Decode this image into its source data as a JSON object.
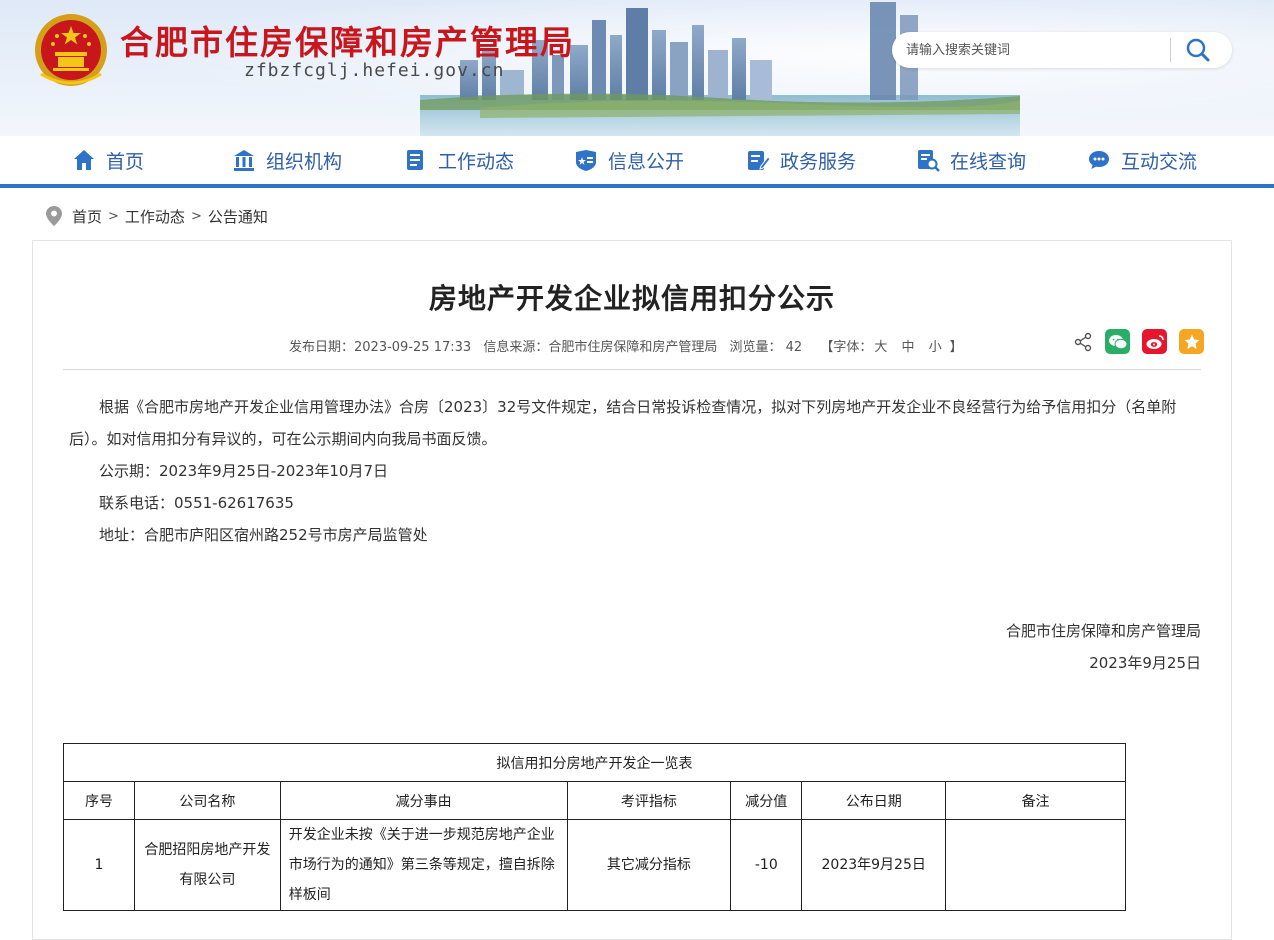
{
  "header": {
    "site_title": "合肥市住房保障和房产管理局",
    "site_domain": "zfbzfcglj.hefei.gov.cn",
    "search": {
      "placeholder": "请输入搜索关键词"
    }
  },
  "nav": {
    "items": [
      {
        "label": "首页",
        "icon": "home-icon"
      },
      {
        "label": "组织机构",
        "icon": "building-icon"
      },
      {
        "label": "工作动态",
        "icon": "document-icon"
      },
      {
        "label": "信息公开",
        "icon": "info-shield-icon"
      },
      {
        "label": "政务服务",
        "icon": "edit-icon"
      },
      {
        "label": "在线查询",
        "icon": "search-doc-icon"
      },
      {
        "label": "互动交流",
        "icon": "chat-icon"
      }
    ],
    "accent": "#2e73c8",
    "text_color": "#2e5fa8"
  },
  "breadcrumb": [
    "首页",
    "工作动态",
    "公告通知"
  ],
  "article": {
    "title": "房地产开发企业拟信用扣分公示",
    "meta": {
      "date_label": "发布日期：",
      "date": "2023-09-25 17:33",
      "source_label": "信息来源：",
      "source": "合肥市住房保障和房产管理局",
      "views_label": "浏览量：",
      "views": "42",
      "font_prefix": "【字体：",
      "font_large": "大",
      "font_medium": "中",
      "font_small": "小",
      "font_suffix": "】"
    },
    "share_icons": [
      "share-icon",
      "wechat-icon",
      "weibo-icon",
      "favorite-icon"
    ],
    "paragraphs": [
      "根据《合肥市房地产开发企业信用管理办法》合房〔2023〕32号文件规定，结合日常投诉检查情况，拟对下列房地产开发企业不良经营行为给予信用扣分（名单附后）。如对信用扣分有异议的，可在公示期间内向我局书面反馈。",
      "公示期：2023年9月25日-2023年10月7日",
      "联系电话：0551-62617635",
      "地址：合肥市庐阳区宿州路252号市房产局监管处"
    ],
    "signature": {
      "org": "合肥市住房保障和房产管理局",
      "date": "2023年9月25日"
    }
  },
  "table": {
    "caption": "拟信用扣分房地产开发企一览表",
    "headers": [
      "序号",
      "公司名称",
      "减分事由",
      "考评指标",
      "减分值",
      "公布日期",
      "备注"
    ],
    "rows": [
      [
        "1",
        "合肥招阳房地产开发有限公司",
        "开发企业未按《关于进一步规范房地产企业市场行为的通知》第三条等规定，擅自拆除样板间",
        "其它减分指标",
        "-10",
        "2023年9月25日",
        ""
      ]
    ]
  },
  "colors": {
    "title_red": "#c8161d",
    "wechat_green": "#2aae67",
    "weibo_red": "#e6162d",
    "favorite_orange": "#f5a623"
  }
}
